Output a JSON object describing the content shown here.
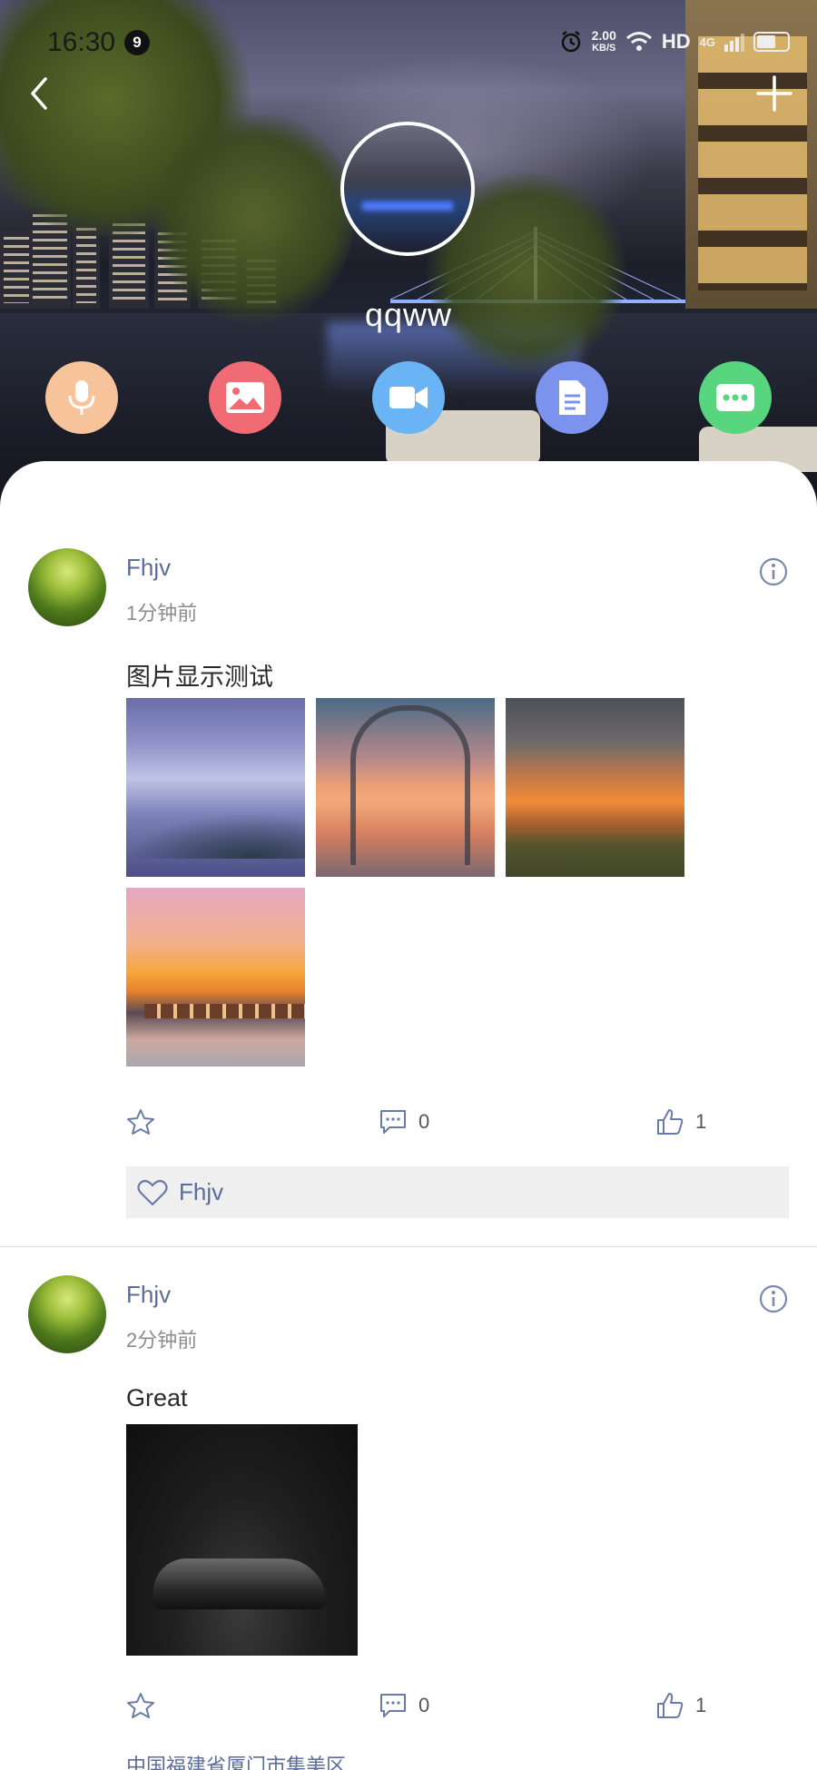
{
  "status_bar": {
    "time": "16:30",
    "notification_count": "9",
    "net_speed": "2.00",
    "net_unit": "KB/S",
    "hd": "HD",
    "net_type": "4G"
  },
  "profile": {
    "name": "qqww"
  },
  "quick_actions": [
    "mic-icon",
    "image-icon",
    "video-icon",
    "document-icon",
    "more-icon"
  ],
  "colors": {
    "voice": "#f7c39a",
    "image": "#f06b73",
    "video": "#6ab3f4",
    "doc": "#7c93ee",
    "more": "#58d57f",
    "link": "#5b6d98"
  },
  "posts": [
    {
      "author": "Fhjv",
      "time": "1分钟前",
      "text": "图片显示测试",
      "comments": "0",
      "likes": "1",
      "liked_by": "Fhjv"
    },
    {
      "author": "Fhjv",
      "time": "2分钟前",
      "text": "Great",
      "comments": "0",
      "likes": "1",
      "location": "中国福建省厦门市集美区"
    }
  ]
}
